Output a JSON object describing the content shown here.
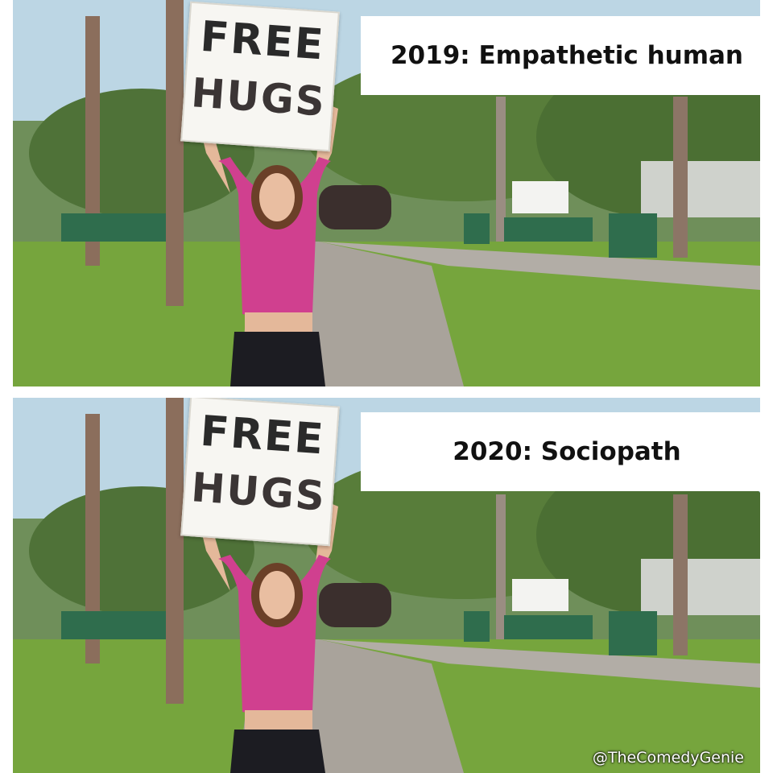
{
  "panels": [
    {
      "sign": {
        "line1": "FREE",
        "line2": "HUGS"
      },
      "caption": "2019: Empathetic human"
    },
    {
      "sign": {
        "line1": "FREE",
        "line2": "HUGS"
      },
      "caption": "2020: Sociopath"
    }
  ],
  "watermark": "@TheComedyGenie",
  "colors": {
    "sky": "#b9d5e4",
    "grass": "#6f9a3c",
    "path": "#a9a39b",
    "shirt": "#d0408f",
    "pants": "#1c1c22",
    "caption_bg": "#ffffff"
  }
}
